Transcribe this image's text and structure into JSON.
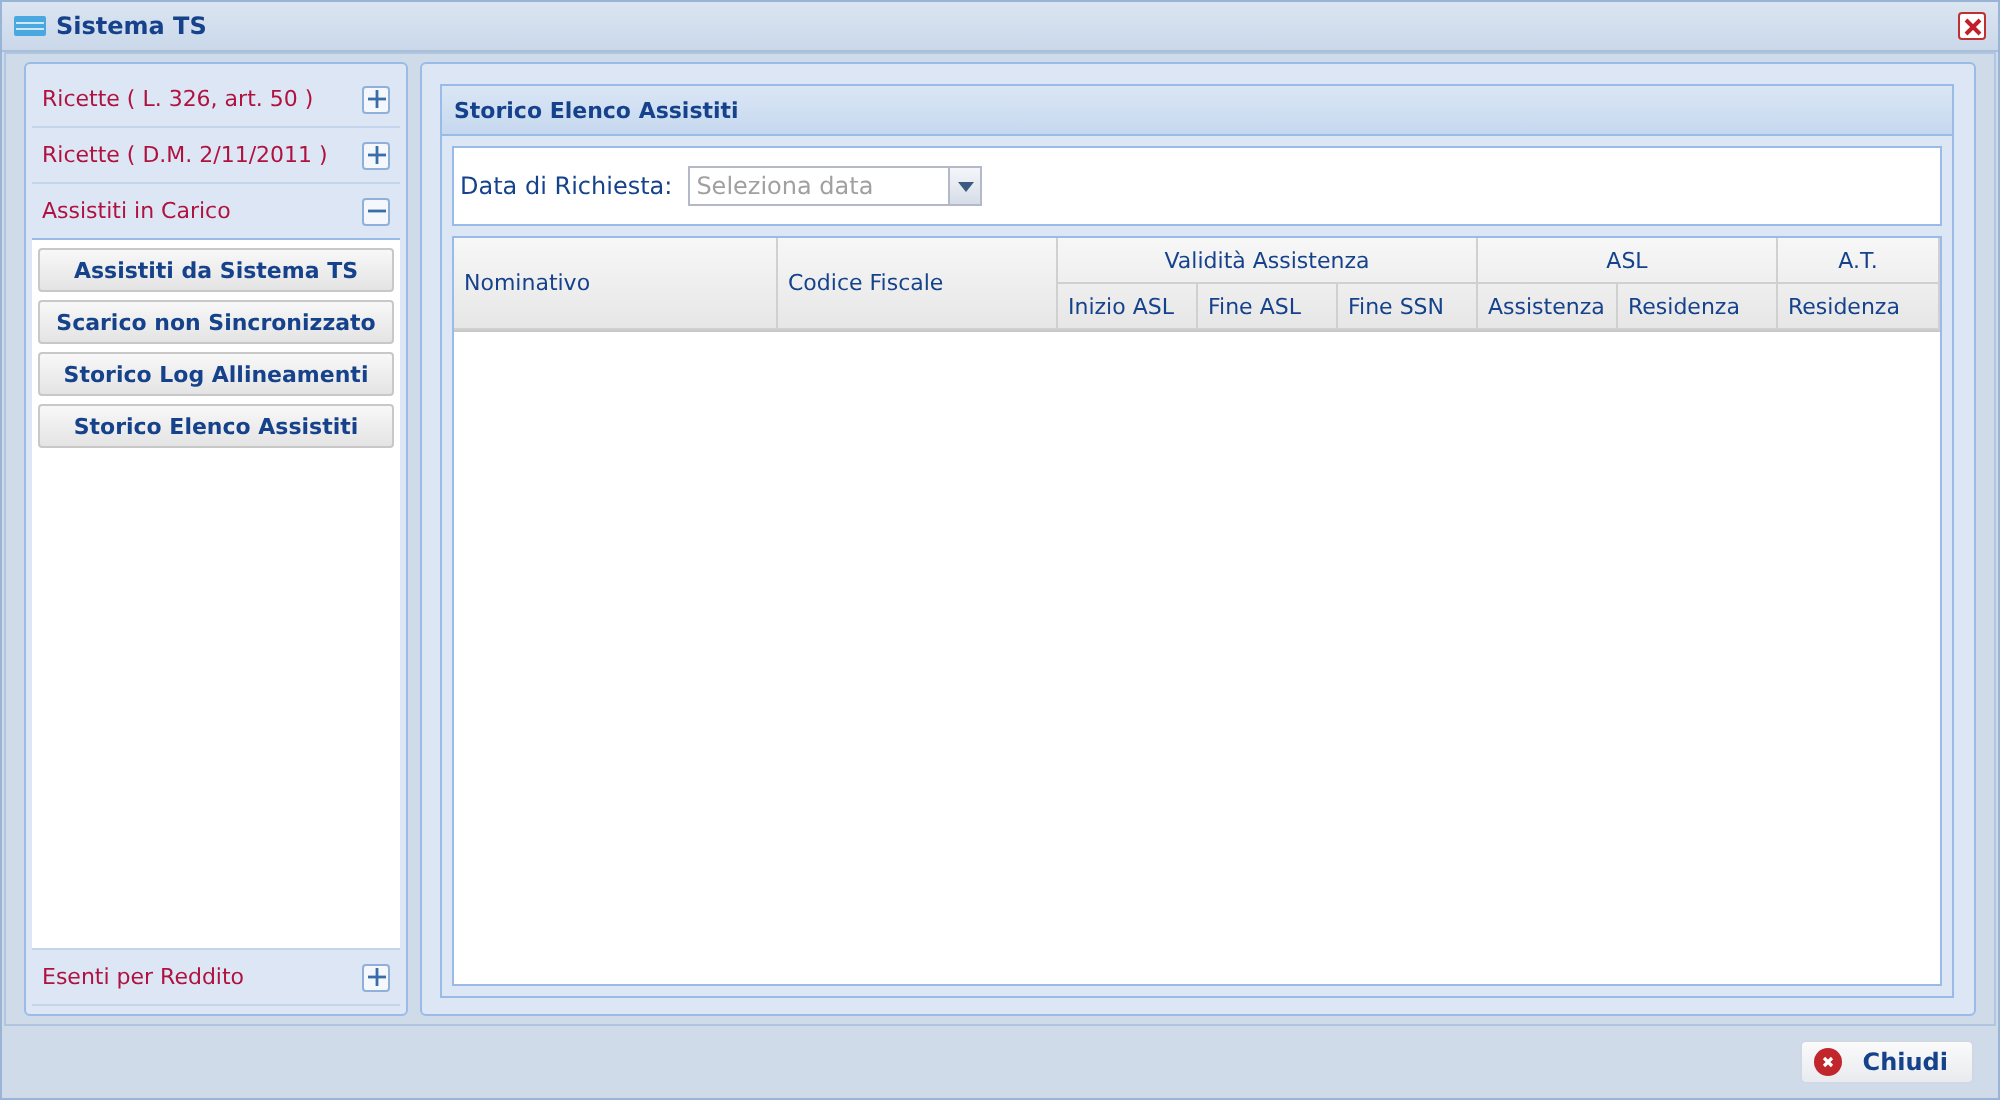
{
  "window": {
    "title": "Sistema TS"
  },
  "sidebar": {
    "sections": [
      {
        "label": "Ricette ( L. 326, art. 50 )",
        "expanded": false
      },
      {
        "label": "Ricette ( D.M. 2/11/2011 )",
        "expanded": false
      },
      {
        "label": "Assistiti in Carico",
        "expanded": true,
        "items": [
          "Assistiti da Sistema TS",
          "Scarico non Sincronizzato",
          "Storico Log Allineamenti",
          "Storico Elenco Assistiti"
        ]
      },
      {
        "label": "Esenti per Reddito",
        "expanded": false
      }
    ]
  },
  "panel": {
    "title": "Storico Elenco Assistiti",
    "date_field": {
      "label": "Data di Richiesta:",
      "placeholder": "Seleziona data"
    },
    "table": {
      "columns": [
        {
          "label": "Nominativo"
        },
        {
          "label": "Codice Fiscale"
        },
        {
          "label": "Validità Assistenza",
          "children": [
            {
              "label": "Inizio ASL"
            },
            {
              "label": "Fine ASL"
            },
            {
              "label": "Fine SSN"
            }
          ]
        },
        {
          "label": "ASL",
          "children": [
            {
              "label": "Assistenza"
            },
            {
              "label": "Residenza"
            }
          ]
        },
        {
          "label": "A.T.",
          "children": [
            {
              "label": "Residenza"
            }
          ]
        }
      ]
    }
  },
  "footer": {
    "close_button": "Chiudi"
  }
}
